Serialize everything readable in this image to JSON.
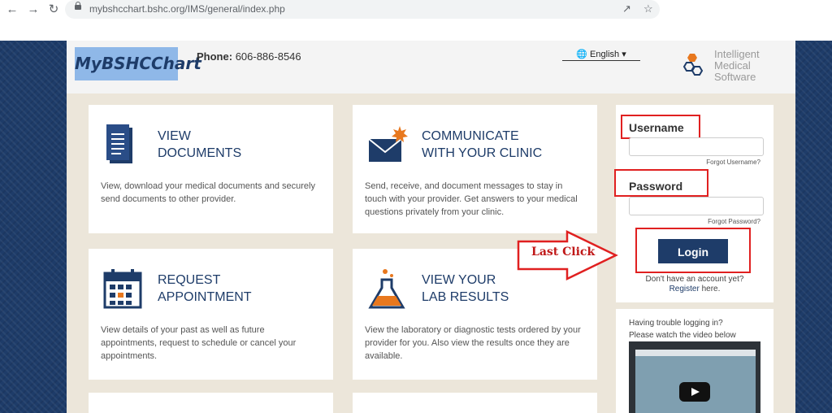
{
  "browser": {
    "url": "mybshcchart.bshc.org/IMS/general/index.php",
    "back_icon": "back-arrow-icon",
    "forward_icon": "forward-arrow-icon",
    "reload_icon": "reload-icon"
  },
  "header": {
    "logo_text": "MyBSHCChart",
    "phone_label": "Phone:",
    "phone_number": "606-886-8546",
    "language": "English",
    "ims_lines": [
      "Intelligent",
      "Medical",
      "Software"
    ]
  },
  "cards": [
    {
      "title1": "VIEW",
      "title2": "DOCUMENTS",
      "desc": "View, download your medical documents and securely send documents to other provider."
    },
    {
      "title1": "COMMUNICATE",
      "title2": "WITH YOUR CLINIC",
      "desc": "Send, receive, and document messages to stay in touch with your provider. Get answers to your medical questions privately from your clinic."
    },
    {
      "title1": "REQUEST",
      "title2": "APPOINTMENT",
      "desc": "View details of your past as well as future appointments, request to schedule or cancel your appointments."
    },
    {
      "title1": "VIEW YOUR",
      "title2": "LAB RESULTS",
      "desc": "View the laboratory or diagnostic tests ordered by your provider for you. Also view the results once they are available."
    }
  ],
  "login": {
    "username_label": "Username",
    "forgot_username": "Forgot Username?",
    "password_label": "Password",
    "forgot_password": "Forgot Password?",
    "login_button": "Login",
    "no_account": "Don't have an account yet?",
    "register_link": "Register",
    "register_suffix": " here."
  },
  "trouble": {
    "line1": "Having trouble logging in?",
    "line2": "Please watch the video below"
  },
  "annotation": {
    "text": "Last Click"
  },
  "colors": {
    "brand_navy": "#1e3c69",
    "accent_orange": "#e8781e",
    "annotation_red": "#e02020"
  }
}
